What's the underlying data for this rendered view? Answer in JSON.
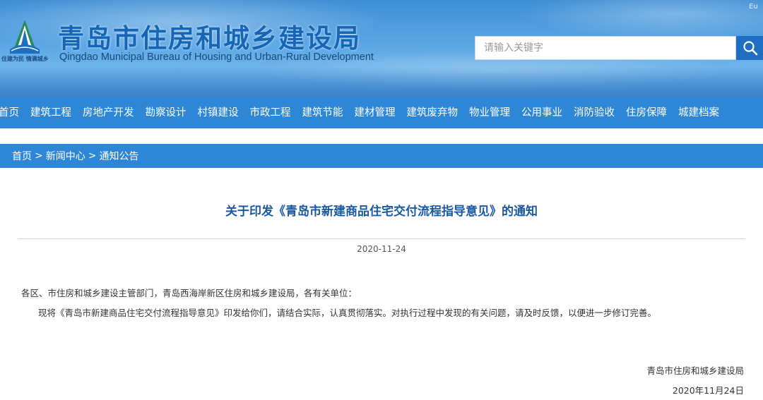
{
  "header": {
    "title": "青岛市住房和城乡建设局",
    "subtitle": "Qingdao Municipal Bureau of Housing and Urban-Rural Development",
    "slogan": "住建为民 情满城乡",
    "corner_text": "Eu",
    "search_placeholder": "请输入关键字"
  },
  "nav": {
    "items": [
      "首页",
      "建筑工程",
      "房地产开发",
      "勘察设计",
      "村镇建设",
      "市政工程",
      "建筑节能",
      "建材管理",
      "建筑废弃物",
      "物业管理",
      "公用事业",
      "消防验收",
      "住房保障",
      "城建档案"
    ]
  },
  "breadcrumb": {
    "items": [
      "首页",
      "新闻中心",
      "通知公告"
    ],
    "separator": ">"
  },
  "article": {
    "title": "关于印发《青岛市新建商品住宅交付流程指导意见》的通知",
    "date": "2020-11-24",
    "salutation": "各区、市住房和城乡建设主管部门，青岛西海岸新区住房和城乡建设局，各有关单位：",
    "body": "现将《青岛市新建商品住宅交付流程指导意见》印发给你们，请结合实际，认真贯彻落实。对执行过程中发现的有关问题，请及时反馈，以便进一步修订完善。",
    "signature": "青岛市住房和城乡建设局",
    "sign_date": "2020年11月24日"
  },
  "colors": {
    "nav_bg": "#2d86d6",
    "title_blue": "#1b5aa0",
    "brand_blue": "#1666b8",
    "search_button": "#1e6fc2"
  }
}
